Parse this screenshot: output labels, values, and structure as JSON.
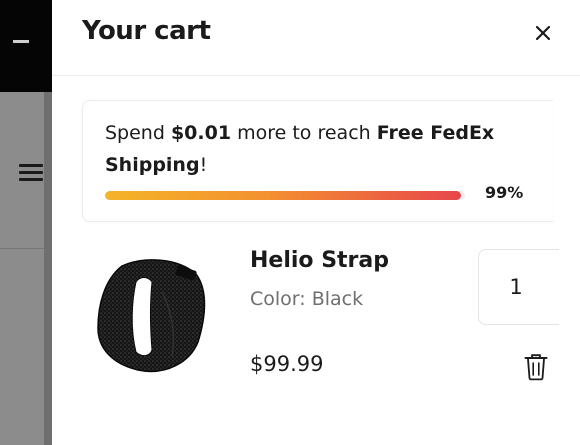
{
  "cart": {
    "title": "Your cart",
    "close_label": "close",
    "shipping": {
      "prefix": "Spend ",
      "amount": "$0.01",
      "middle": " more to reach ",
      "goal_part1": "Free FedEx",
      "goal_part2": "Shipping",
      "suffix": "!",
      "progress_label": "99%",
      "progress_fraction": 0.99,
      "gradient_colors": [
        "#f5b428",
        "#f39130",
        "#e8464b"
      ]
    },
    "items": [
      {
        "name": "Helio Strap",
        "variant": "Color: Black",
        "price": "$99.99",
        "quantity": "1",
        "image_icon": "black-loop-strap-image",
        "remove_icon": "trash-icon"
      }
    ]
  },
  "background": {
    "menu_icon": "hamburger-menu-icon"
  }
}
